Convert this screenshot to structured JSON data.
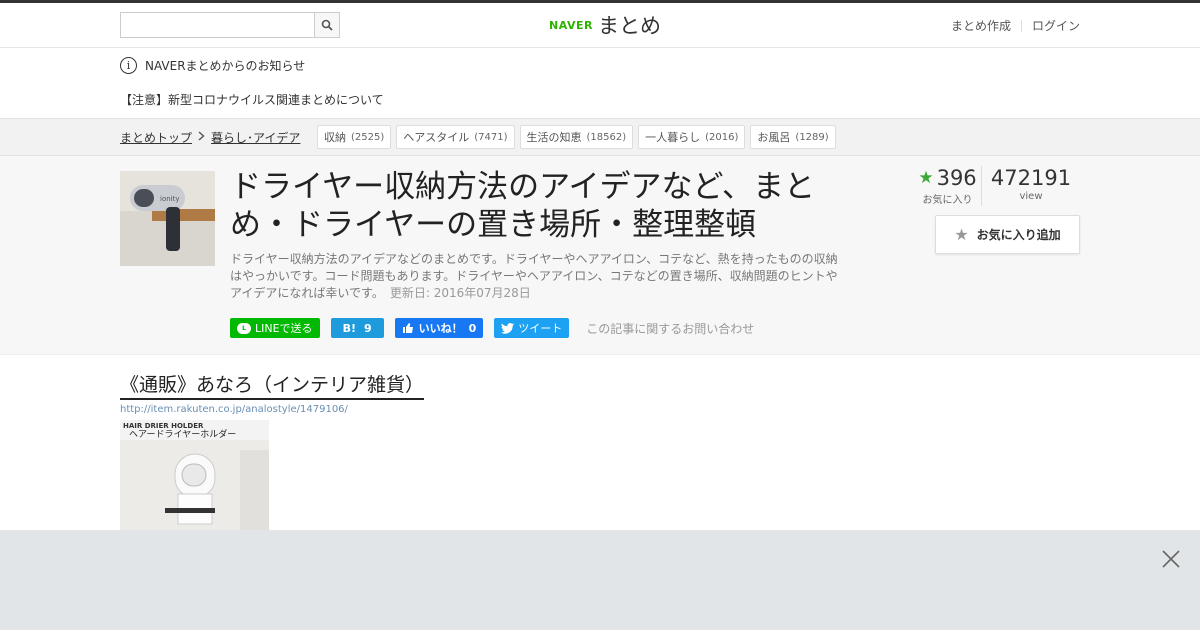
{
  "header": {
    "search": {
      "value": "",
      "placeholder": ""
    },
    "logo": {
      "brand": "NAVER",
      "product": "まとめ"
    },
    "nav": {
      "create": "まとめ作成",
      "login": "ログイン"
    }
  },
  "notice": {
    "title": "NAVERまとめからのお知らせ",
    "alert": "【注意】新型コロナウイルス関連まとめについて"
  },
  "breadcrumb": {
    "items": [
      "まとめトップ",
      "暮らし･アイデア"
    ]
  },
  "tags": [
    {
      "label": "収納",
      "count": "(2525)"
    },
    {
      "label": "ヘアスタイル",
      "count": "(7471)"
    },
    {
      "label": "生活の知恵",
      "count": "(18562)"
    },
    {
      "label": "一人暮らし",
      "count": "(2016)"
    },
    {
      "label": "お風呂",
      "count": "(1289)"
    }
  ],
  "article": {
    "title": "ドライヤー収納方法のアイデアなど、まとめ・ドライヤーの置き場所・整理整頓",
    "description": "ドライヤー収納方法のアイデアなどのまとめです。ドライヤーやヘアアイロン、コテなど、熱を持ったものの収納はやっかいです。コード問題もあります。ドライヤーやヘアアイロン、コテなどの置き場所、収納問題のヒントやアイデアになれば幸いです。",
    "updated": "更新日: 2016年07月28日",
    "favorites": "396",
    "favorites_label": "お気に入り",
    "views": "472191",
    "views_label": "view",
    "fav_button": "お気に入り追加",
    "thumb_brand": "ionity"
  },
  "share": {
    "line": "LINEで送る",
    "hatena_mark": "B!",
    "hatena_count": "9",
    "facebook": "いいね！",
    "facebook_count": "0",
    "twitter": "ツイート",
    "contact": "この記事に関するお問い合わせ"
  },
  "section": {
    "title": "《通販》あなろ（インテリア雑貨）",
    "url": "http://item.rakuten.co.jp/analostyle/1479106/",
    "image_caption_en": "HAIR DRIER HOLDER",
    "image_caption_ja": "ヘアードライヤーホルダー"
  },
  "colors": {
    "naver_green": "#2db400",
    "line_green": "#00b900",
    "hatena_blue": "#1e9bdc",
    "facebook_blue": "#1877f2",
    "twitter_blue": "#1da1f2",
    "star_green": "#3aaa35"
  }
}
